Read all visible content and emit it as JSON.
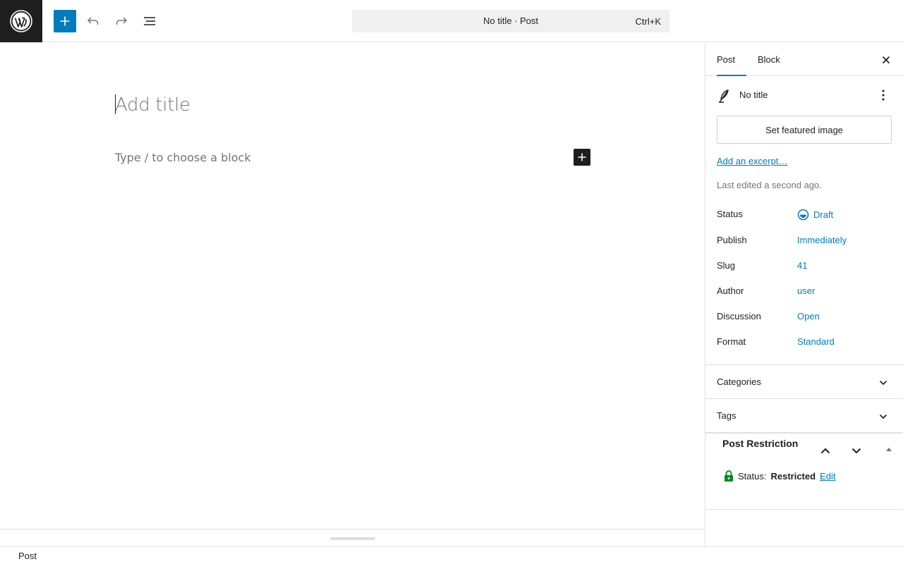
{
  "toolbar": {
    "command_bar_title": "No title · Post",
    "command_bar_shortcut": "Ctrl+K"
  },
  "editor": {
    "title_placeholder": "Add title",
    "block_placeholder": "Type / to choose a block"
  },
  "sidebar": {
    "tabs": [
      {
        "label": "Post",
        "active": true
      },
      {
        "label": "Block",
        "active": false
      }
    ],
    "post_title": "No title",
    "featured_image_label": "Set featured image",
    "excerpt_link": "Add an excerpt…",
    "last_edited": "Last edited a second ago.",
    "properties": [
      {
        "label": "Status",
        "value": "Draft"
      },
      {
        "label": "Publish",
        "value": "Immediately"
      },
      {
        "label": "Slug",
        "value": "41"
      },
      {
        "label": "Author",
        "value": "user"
      },
      {
        "label": "Discussion",
        "value": "Open"
      },
      {
        "label": "Format",
        "value": "Standard"
      }
    ],
    "panels": [
      {
        "title": "Categories"
      },
      {
        "title": "Tags"
      }
    ],
    "restriction": {
      "title": "Post Restriction",
      "status_prefix": "Status:",
      "status_value": "Restricted",
      "edit_label": "Edit"
    }
  },
  "footer": {
    "breadcrumb": "Post"
  },
  "colors": {
    "accent": "#007cba",
    "dark": "#1e1e1e",
    "lock": "#008a20"
  }
}
